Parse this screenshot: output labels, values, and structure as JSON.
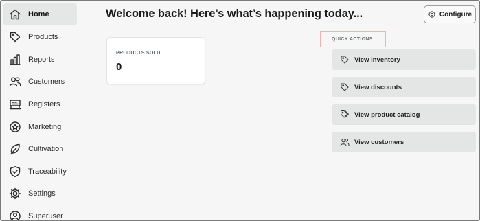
{
  "sidebar": {
    "items": [
      {
        "label": "Home",
        "icon": "home-icon",
        "active": true
      },
      {
        "label": "Products",
        "icon": "tag-icon",
        "active": false
      },
      {
        "label": "Reports",
        "icon": "bar-chart-icon",
        "active": false
      },
      {
        "label": "Customers",
        "icon": "users-icon",
        "active": false
      },
      {
        "label": "Registers",
        "icon": "register-icon",
        "active": false
      },
      {
        "label": "Marketing",
        "icon": "star-badge-icon",
        "active": false
      },
      {
        "label": "Cultivation",
        "icon": "leaf-icon",
        "active": false
      },
      {
        "label": "Traceability",
        "icon": "shield-check-icon",
        "active": false
      },
      {
        "label": "Settings",
        "icon": "gear-icon",
        "active": false
      },
      {
        "label": "Superuser",
        "icon": "superuser-icon",
        "active": false
      }
    ]
  },
  "header": {
    "title": "Welcome back! Here’s what’s happening today...",
    "configure_label": "Configure"
  },
  "stats": {
    "products_sold_label": "PRODUCTS SOLD",
    "products_sold_value": "0"
  },
  "quick_actions": {
    "heading": "QUICK ACTIONS",
    "items": [
      {
        "label": "View inventory",
        "icon": "tag-icon"
      },
      {
        "label": "View discounts",
        "icon": "tag-icon"
      },
      {
        "label": "View product catalog",
        "icon": "tags-icon"
      },
      {
        "label": "View customers",
        "icon": "users-icon"
      }
    ]
  },
  "colors": {
    "background": "#f6f6f6",
    "active_nav": "#e5e6e6",
    "quick_action_bg": "#e4e5e5",
    "highlight_border": "#f0b4ae"
  }
}
